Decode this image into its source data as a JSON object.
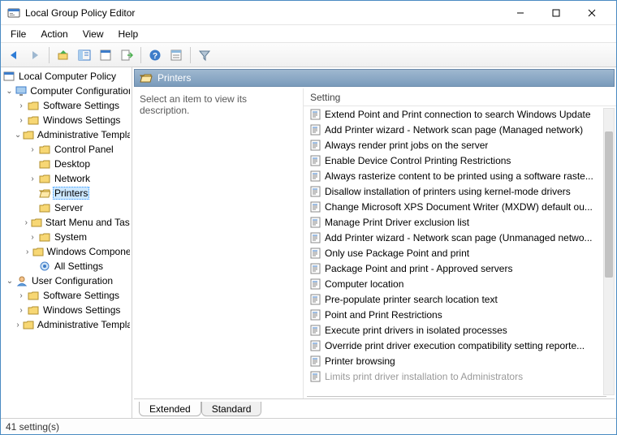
{
  "window": {
    "title": "Local Group Policy Editor"
  },
  "menu": {
    "file": "File",
    "action": "Action",
    "view": "View",
    "help": "Help"
  },
  "toolbar": {
    "back": "Back",
    "forward": "Forward",
    "up": "Up",
    "show_hide_tree": "Show/Hide Console Tree",
    "properties": "Properties",
    "export": "Export List",
    "help": "Help",
    "options": "Options",
    "filter": "Filter"
  },
  "tree": {
    "root": "Local Computer Policy",
    "computer_config": "Computer Configuration",
    "software_settings": "Software Settings",
    "windows_settings": "Windows Settings",
    "admin_templates": "Administrative Templates",
    "control_panel": "Control Panel",
    "desktop": "Desktop",
    "network": "Network",
    "printers": "Printers",
    "server": "Server",
    "start_menu": "Start Menu and Taskbar",
    "system": "System",
    "windows_comp": "Windows Components",
    "all_settings": "All Settings",
    "user_config": "User Configuration",
    "u_software": "Software Settings",
    "u_windows": "Windows Settings",
    "u_admin": "Administrative Templates"
  },
  "details": {
    "category_title": "Printers",
    "description_prompt": "Select an item to view its description.",
    "column_header": "Setting",
    "settings": [
      "Extend Point and Print connection to search Windows Update",
      "Add Printer wizard - Network scan page (Managed network)",
      "Always render print jobs on the server",
      "Enable Device Control Printing Restrictions",
      "Always rasterize content to be printed using a software raste...",
      "Disallow installation of printers using kernel-mode drivers",
      "Change Microsoft XPS Document Writer (MXDW) default ou...",
      "Manage Print Driver exclusion list",
      "Add Printer wizard - Network scan page (Unmanaged netwo...",
      "Only use Package Point and print",
      "Package Point and print - Approved servers",
      "Computer location",
      "Pre-populate printer search location text",
      "Point and Print Restrictions",
      "Execute print drivers in isolated processes",
      "Override print driver execution compatibility setting reporte...",
      "Printer browsing",
      "Limits print driver installation to Administrators"
    ]
  },
  "tabs": {
    "extended": "Extended",
    "standard": "Standard"
  },
  "status": {
    "text": "41 setting(s)"
  }
}
